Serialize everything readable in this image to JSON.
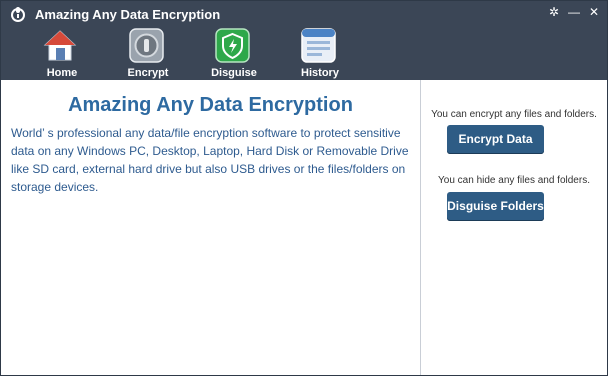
{
  "window": {
    "title": "Amazing Any Data Encryption",
    "controls": [
      "settings-icon",
      "minimize-icon",
      "close-icon"
    ]
  },
  "nav": {
    "items": [
      {
        "label": "Home",
        "icon": "home-icon"
      },
      {
        "label": "Encrypt",
        "icon": "lock-icon"
      },
      {
        "label": "Disguise",
        "icon": "shield-icon"
      },
      {
        "label": "History",
        "icon": "history-icon"
      }
    ]
  },
  "main": {
    "title": "Amazing Any Data Encryption",
    "description": "World’ s professional any data/file encryption software to protect sensitive data on any Windows PC, Desktop, Laptop, Hard Disk or Removable Drive like SD card, external hard drive but also USB drives or the files/folders on storage devices."
  },
  "side": {
    "encrypt_hint": "You can encrypt any files and folders.",
    "encrypt_button": "Encrypt Data",
    "disguise_hint": "You can hide any files and folders.",
    "disguise_button": "Disguise Folders"
  },
  "colors": {
    "header_bg": "#3b4656",
    "accent_blue": "#2e6aa1",
    "button_bg": "#2e5c85"
  }
}
